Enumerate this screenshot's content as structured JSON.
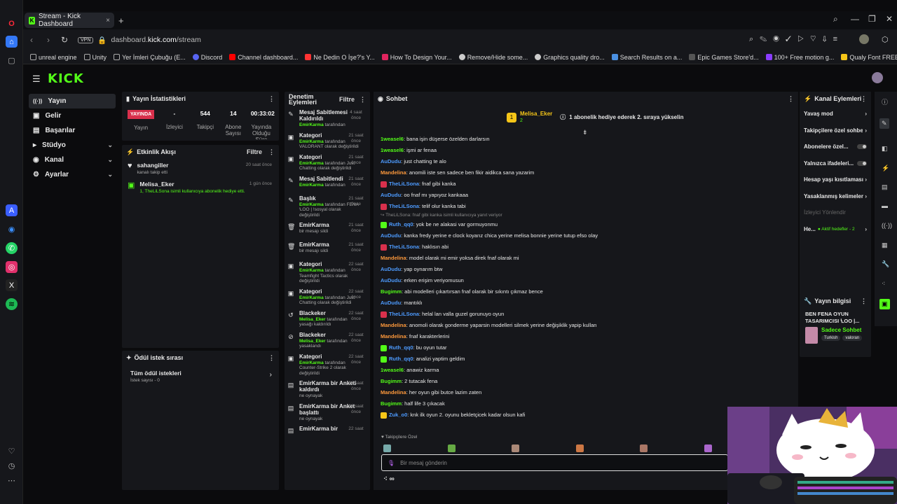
{
  "browser": {
    "tab_title": "Stream - Kick Dashboard",
    "url_domain": "dashboard.",
    "url_host": "kick.com",
    "url_path": "/stream",
    "vpn_label": "VPN",
    "bookmarks": [
      "unreal engine",
      "Unity",
      "Yer İmleri Çubuğu (E...",
      "Discord",
      "Channel dashboard...",
      "Ne Dedin O İşe?'s Y...",
      "How To Design Your...",
      "Remove/Hide some...",
      "Graphics quality dro...",
      "Search Results on a...",
      "Epic Games Store'd...",
      "100+ Free motion g...",
      "Qualy Font FREE Do..."
    ]
  },
  "logo": "KICK",
  "nav": {
    "items": [
      {
        "label": "Yayın",
        "icon": "((·))"
      },
      {
        "label": "Gelir",
        "icon": "▣"
      },
      {
        "label": "Başarılar",
        "icon": "▤"
      },
      {
        "label": "Stüdyo",
        "icon": "▸"
      },
      {
        "label": "Kanal",
        "icon": "◉"
      },
      {
        "label": "Ayarlar",
        "icon": "⚙"
      }
    ]
  },
  "stats": {
    "title": "Yayın İstatistikleri",
    "live_badge": "YAYINDA",
    "live_label": "Yayın",
    "viewers_value": "-",
    "viewers_label": "İzleyici",
    "followers_value": "544",
    "followers_label": "Takipçi",
    "subs_value": "14",
    "subs_label": "Abone Sayısı",
    "uptime_value": "00:33:02",
    "uptime_label": "Yayında Olduğu Süre"
  },
  "activity": {
    "title": "Etkinlik Akışı",
    "filter": "Filtre",
    "items": [
      {
        "user": "sahangiller",
        "text": "kanalı takip etti",
        "time": "20 saat önce"
      },
      {
        "user": "Melisa_Eker",
        "text": "1, TheLiLSona isimli kullanıcıya abonelik hediye etti.",
        "time": "1 gün önce"
      }
    ]
  },
  "rewards": {
    "title": "Ödül istek sırası",
    "item": "Tüm ödül istekleri",
    "sub": "İstek sayısı - 0"
  },
  "mod": {
    "title": "Denetim Eylemleri",
    "filter": "Filtre",
    "items": [
      {
        "icon": "✎",
        "title": "Mesaj Sabitlemesi Kaldırıldı",
        "user": "EmirKarma",
        "desc": " tarafından",
        "time": "4 saat önce"
      },
      {
        "icon": "▣",
        "title": "Kategori",
        "user": "EmirKarma",
        "desc": " tarafından VALORANT olarak değiştirildi",
        "time": "21 saat önce"
      },
      {
        "icon": "▣",
        "title": "Kategori",
        "user": "EmirKarma",
        "desc": " tarafından Just Chatting olarak değiştirildi",
        "time": "21 saat önce"
      },
      {
        "icon": "✎",
        "title": "Mesaj Sabitlendi",
        "user": "EmirKarma",
        "desc": " tarafından",
        "time": "21 saat önce"
      },
      {
        "icon": "✎",
        "title": "Başlık",
        "user": "EmirKarma",
        "desc": " tarafından FENA ꝆOO | !sosyal olarak değiştirildi",
        "time": "21 saat önce"
      },
      {
        "icon": "🗑",
        "title": "EmirKarma",
        "user": "",
        "desc": "bir mesajı sildi",
        "time": "21 saat önce"
      },
      {
        "icon": "🗑",
        "title": "EmirKarma",
        "user": "",
        "desc": "bir mesajı sildi",
        "time": "21 saat önce"
      },
      {
        "icon": "▣",
        "title": "Kategori",
        "user": "EmirKarma",
        "desc": " tarafından Teamfight Tactics olarak değiştirildi",
        "time": "22 saat önce"
      },
      {
        "icon": "▣",
        "title": "Kategori",
        "user": "EmirKarma",
        "desc": " tarafından Just Chatting olarak değiştirildi",
        "time": "22 saat önce"
      },
      {
        "icon": "↺",
        "title": "Blackeker",
        "user": "Melisa_Eker",
        "desc": " tarafından yasağı kaldırıldı",
        "time": "22 saat önce"
      },
      {
        "icon": "⊘",
        "title": "Blackeker",
        "user": "Melisa_Eker",
        "desc": " tarafından yasaklandı",
        "time": "22 saat önce"
      },
      {
        "icon": "▣",
        "title": "Kategori",
        "user": "EmirKarma",
        "desc": " tarafından Counter-Strike 2 olarak değiştirildi",
        "time": "22 saat önce"
      },
      {
        "icon": "▤",
        "title": "EmirKarma bir Anketi kaldırdı",
        "user": "",
        "desc": "ne oynayak",
        "time": "22 saat önce"
      },
      {
        "icon": "▤",
        "title": "EmirKarma bir Anket başlattı",
        "user": "",
        "desc": "ne oynayak",
        "time": "22 saat önce"
      },
      {
        "icon": "▤",
        "title": "EmirKarma bir",
        "user": "",
        "desc": "",
        "time": "22 saat"
      }
    ]
  },
  "chat": {
    "title": "Sohbet",
    "pinned_user": "Melisa_Eker",
    "pinned_count": "2",
    "pinned_text": "1 abonelik hediye ederek 2. sıraya yükselin",
    "messages": [
      {
        "user": "1weasel6",
        "color": "#53fc18",
        "text": ": bana işin düşerse özelden darlarsın"
      },
      {
        "user": "1weasel6",
        "color": "#53fc18",
        "text": ": işmi ar fenaa"
      },
      {
        "user": "AuDudu",
        "color": "#4d9bff",
        "text": ": just chatting te alo"
      },
      {
        "user": "Mandelina",
        "color": "#ff9a3c",
        "text": ": anomili iste sen sadece ben fikir aidikca sana yazarim"
      },
      {
        "user": "TheLiLSona",
        "color": "#4d9bff",
        "badge": "#d9304c",
        "text": ": fnaf gibi kanka"
      },
      {
        "user": "AuDudu",
        "color": "#4d9bff",
        "text": ": oo fnaf mı yapıyoz kankaaa"
      },
      {
        "user": "TheLiLSona",
        "color": "#4d9bff",
        "badge": "#d9304c",
        "text": ": telif olur kanka tabi"
      },
      {
        "reply": "↪ TheLiLSona: fnaf gibi kanka isimli kullanıcıya yanıt veriyor"
      },
      {
        "user": "Ruth_qq0",
        "color": "#4d9bff",
        "badge": "#53fc18",
        "text": ": yok be ne alakasi var gormuyonmu"
      },
      {
        "user": "AuDudu",
        "color": "#4d9bff",
        "text": ": kanka fredy yerine e clock koyarız chica yerine melisa bonnie yerine tutup efso olay"
      },
      {
        "user": "TheLiLSona",
        "color": "#4d9bff",
        "badge": "#d9304c",
        "text": ": haklısın abi"
      },
      {
        "user": "Mandelina",
        "color": "#ff9a3c",
        "text": ": model olarak mi emir yoksa direk fnaf olarak mi"
      },
      {
        "user": "AuDudu",
        "color": "#4d9bff",
        "text": ": yap oynarım btw"
      },
      {
        "user": "AuDudu",
        "color": "#4d9bff",
        "text": ": erken erişim veriyomusun"
      },
      {
        "user": "Bugimm",
        "color": "#53fc18",
        "text": ": abi modelleri çıkartırsan fnaf olarak bir sıkıntı çıkmaz bence"
      },
      {
        "user": "AuDudu",
        "color": "#4d9bff",
        "text": ": mantıklı"
      },
      {
        "user": "TheLiLSona",
        "color": "#4d9bff",
        "badge": "#d9304c",
        "text": ": helal lan valla guzel gorunuyo oyun"
      },
      {
        "user": "Mandelina",
        "color": "#ff9a3c",
        "text": ": anomoli olarak gonderme yaparsin modelleri silmek yerine değişiklik yapip kullan"
      },
      {
        "user": "Mandelina",
        "color": "#ff9a3c",
        "text": ": fnaf karakterlerini"
      },
      {
        "user": "Ruth_qq0",
        "color": "#4d9bff",
        "badge": "#53fc18",
        "text": ": bu oyun tutar"
      },
      {
        "user": "Ruth_qq0",
        "color": "#4d9bff",
        "badge": "#53fc18",
        "text": ": analizi yaptim geldim"
      },
      {
        "user": "1weasel6",
        "color": "#53fc18",
        "text": ": anawiz karma"
      },
      {
        "user": "Bugimm",
        "color": "#53fc18",
        "text": ": 2 tutacak fena"
      },
      {
        "user": "Mandelina",
        "color": "#ff9a3c",
        "text": ": her oyun gibi butce lazim zaten"
      },
      {
        "user": "Bugimm",
        "color": "#53fc18",
        "text": ": half life 3 çıkacak"
      },
      {
        "user": "Zuk_o0",
        "color": "#4d9bff",
        "badge": "#f5c518",
        "text": ": knk ilk oyun 2. oyunu bekletçicek kadar olsun kafi"
      }
    ],
    "emote_label": "♥ Takipçilere Özel",
    "input_placeholder": "Bir mesaj gönderin",
    "points": "∞"
  },
  "channel": {
    "title": "Kanal Eylemleri",
    "items": [
      "Yavaş mod",
      "Takipçilere özel sohbet",
      "Abonelere özel...",
      "Yalnızca ifadeleri...",
      "Hesap yaşı kısıtlaması",
      "Yasaklanmış kelimeler",
      "İzleyici Yönlendir",
      "He..."
    ],
    "host_status": "● Aktif hedefler - 2"
  },
  "info": {
    "title": "Yayın bilgisi",
    "stream_title": "BEN FENA OYUN TASARIMCISI ꝆOO |...",
    "mode": "Sadece Sohbet",
    "tags": [
      "Turkish",
      "valoran"
    ]
  },
  "colors": {
    "accent": "#53fc18",
    "live": "#d9304c",
    "panel": "#16171b"
  }
}
